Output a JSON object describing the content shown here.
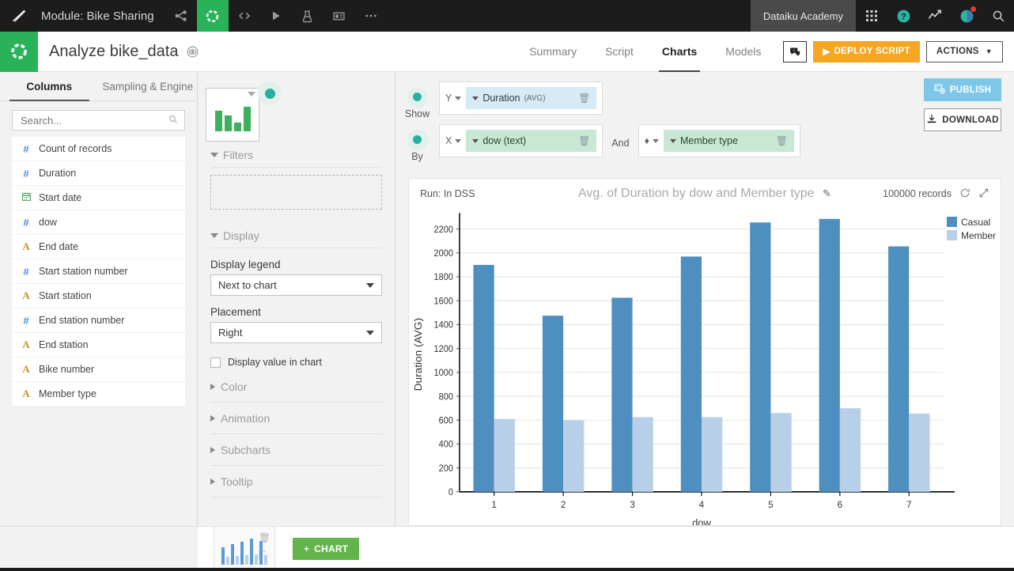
{
  "topbar": {
    "module_title": "Module: Bike Sharing",
    "logo_icon": "dataiku-logo-icon",
    "icons": [
      {
        "name": "flow-icon",
        "glyph": "flow",
        "active": false
      },
      {
        "name": "dataset-icon",
        "glyph": "donut",
        "active": true
      },
      {
        "name": "code-icon",
        "glyph": "</>",
        "active": false
      },
      {
        "name": "jobs-icon",
        "glyph": "play",
        "active": false
      },
      {
        "name": "lab-icon",
        "glyph": "lab",
        "active": false
      },
      {
        "name": "dashboard-icon",
        "glyph": "dashboard",
        "active": false
      },
      {
        "name": "more-icon",
        "glyph": "...",
        "active": false
      }
    ],
    "account_label": "Dataiku Academy",
    "right_icons": [
      "apps-grid-icon",
      "help-icon",
      "activity-icon",
      "profile-avatar-icon",
      "search-icon"
    ]
  },
  "header": {
    "title": "Analyze bike_data",
    "eye_icon": "visibility-icon",
    "tabs": [
      {
        "label": "Summary",
        "selected": false
      },
      {
        "label": "Script",
        "selected": false
      },
      {
        "label": "Charts",
        "selected": true
      },
      {
        "label": "Models",
        "selected": false
      }
    ],
    "comment_icon": "comment-add-icon",
    "deploy_label": "DEPLOY SCRIPT",
    "actions_label": "ACTIONS",
    "deploy_color": "#f5a623"
  },
  "left_panel": {
    "tabs": [
      {
        "label": "Columns",
        "selected": true
      },
      {
        "label": "Sampling & Engine",
        "selected": false
      }
    ],
    "search_placeholder": "Search...",
    "search_value": "",
    "columns": [
      {
        "name": "Count of records",
        "type": "number",
        "icon": "#"
      },
      {
        "name": "Duration",
        "type": "number",
        "icon": "#"
      },
      {
        "name": "Start date",
        "type": "date",
        "icon": "calendar"
      },
      {
        "name": "dow",
        "type": "number",
        "icon": "#"
      },
      {
        "name": "End date",
        "type": "string",
        "icon": "A"
      },
      {
        "name": "Start station number",
        "type": "number",
        "icon": "#"
      },
      {
        "name": "Start station",
        "type": "string",
        "icon": "A"
      },
      {
        "name": "End station number",
        "type": "number",
        "icon": "#"
      },
      {
        "name": "End station",
        "type": "string",
        "icon": "A"
      },
      {
        "name": "Bike number",
        "type": "string",
        "icon": "A"
      },
      {
        "name": "Member type",
        "type": "string",
        "icon": "A"
      }
    ]
  },
  "settings": {
    "chart_type_icon": "bar-chart-thumbnail",
    "sections": {
      "filters_label": "Filters",
      "display_label": "Display",
      "color_label": "Color",
      "animation_label": "Animation",
      "subcharts_label": "Subcharts",
      "tooltip_label": "Tooltip"
    },
    "display_legend_label": "Display legend",
    "display_legend_value": "Next to chart",
    "placement_label": "Placement",
    "placement_value": "Right",
    "display_value_label": "Display value in chart",
    "display_value_checked": false
  },
  "dropzones": {
    "show_label": "Show",
    "by_label": "By",
    "and_label": "And",
    "y": {
      "axis": "Y",
      "field": "Duration",
      "agg": "(AVG)",
      "color": "#d7ebf5"
    },
    "x": {
      "axis": "X",
      "field": "dow (text)",
      "color": "#c8e8d4"
    },
    "group": {
      "axis": "color-drop",
      "field": "Member type",
      "color": "#c8e8d4"
    }
  },
  "actions": {
    "publish_label": "PUBLISH",
    "publish_icon": "publish-icon",
    "download_label": "DOWNLOAD",
    "download_icon": "download-icon"
  },
  "chart_card": {
    "run_label": "Run: In DSS",
    "title": "Avg. of Duration by dow and Member type",
    "edit_icon": "pencil-icon",
    "records_label": "100000 records",
    "refresh_icon": "refresh-icon",
    "expand_icon": "expand-icon"
  },
  "bottom": {
    "thumb_icon": "chart-thumbnail",
    "delete_icon": "trash-icon",
    "copy_icon": "copy-icon",
    "add_chart_label": "CHART",
    "add_chart_plus": "+"
  },
  "chart_data": {
    "type": "bar",
    "title": "Avg. of Duration by dow and Member type",
    "xlabel": "dow",
    "ylabel": "Duration (AVG)",
    "categories": [
      "1",
      "2",
      "3",
      "4",
      "5",
      "6",
      "7"
    ],
    "series": [
      {
        "name": "Casual",
        "color": "#4f8fc0",
        "values": [
          1900,
          1475,
          1625,
          1970,
          2255,
          2285,
          2055
        ]
      },
      {
        "name": "Member",
        "color": "#b8cfe8",
        "values": [
          610,
          598,
          625,
          625,
          660,
          700,
          655
        ]
      }
    ],
    "ylim": [
      0,
      2300
    ],
    "yticks": [
      0,
      200,
      400,
      600,
      800,
      1000,
      1200,
      1400,
      1600,
      1800,
      2000,
      2200
    ],
    "grid": true,
    "legend_position": "right",
    "legend_entries": [
      "Casual",
      "Member"
    ]
  }
}
